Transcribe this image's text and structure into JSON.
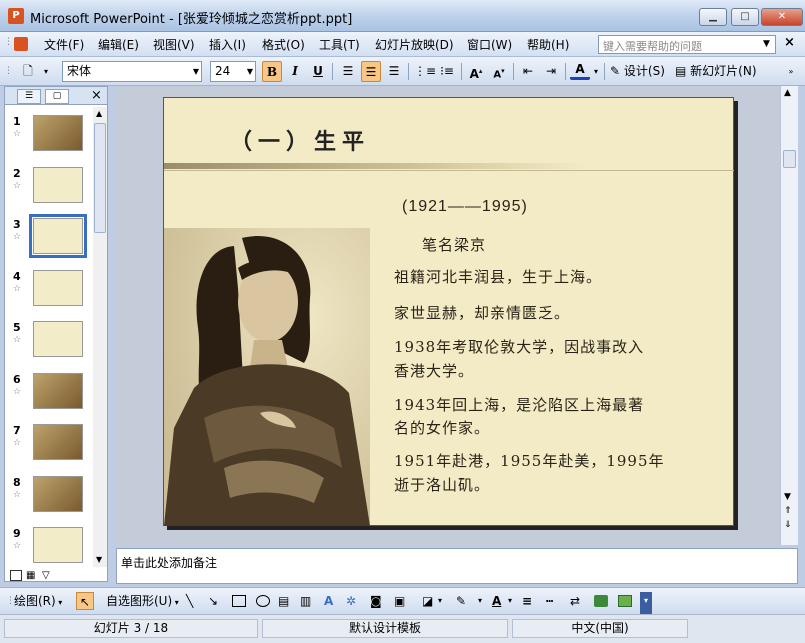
{
  "window": {
    "title": "Microsoft PowerPoint - [张爱玲倾城之恋赏析ppt.ppt]",
    "app_icon": "P"
  },
  "window_controls": {
    "minimize": "▁",
    "maximize": "□",
    "close": "✕"
  },
  "menu": {
    "items": [
      "文件(F)",
      "编辑(E)",
      "视图(V)",
      "插入(I)",
      "格式(O)",
      "工具(T)",
      "幻灯片放映(D)",
      "窗口(W)",
      "帮助(H)"
    ],
    "help_placeholder": "键入需要帮助的问题",
    "close": "×"
  },
  "toolbar": {
    "font": "宋体",
    "size": "24",
    "bold": "B",
    "italic": "I",
    "underline": "U",
    "design_label": "设计(S)",
    "new_slide_label": "新幻灯片(N)",
    "font_color": "#1f3fbf",
    "highlight_color": "#f8c685"
  },
  "slides_pane": {
    "tab_outline": "☰",
    "tab_slides": "▢",
    "close": "×",
    "thumbnails": [
      {
        "number": "1",
        "style": "dark"
      },
      {
        "number": "2",
        "style": "light"
      },
      {
        "number": "3",
        "style": "light",
        "selected": true
      },
      {
        "number": "4",
        "style": "light"
      },
      {
        "number": "5",
        "style": "light"
      },
      {
        "number": "6",
        "style": "dark"
      },
      {
        "number": "7",
        "style": "dark"
      },
      {
        "number": "8",
        "style": "dark"
      },
      {
        "number": "9",
        "style": "light"
      }
    ]
  },
  "slide": {
    "title": "（一）生平",
    "dates": "(1921——1995)",
    "pen_name": "笔名梁京",
    "lines": [
      "祖籍河北丰润县，生于上海。",
      "家世显赫，却亲情匮乏。",
      "1938年考取伦敦大学，因战事改入",
      "香港大学。",
      "1943年回上海，是沦陷区上海最著",
      "名的女作家。",
      "1951年赴港，1955年赴美，1995年",
      "逝于洛山矶。"
    ],
    "background": "#f2ebc6"
  },
  "notes": {
    "placeholder": "单击此处添加备注"
  },
  "drawing_toolbar": {
    "draw_label": "绘图(R)",
    "autoshapes_label": "自选图形(U)"
  },
  "status": {
    "slide": "幻灯片 3 / 18",
    "design": "默认设计模板",
    "language": "中文(中国)"
  }
}
